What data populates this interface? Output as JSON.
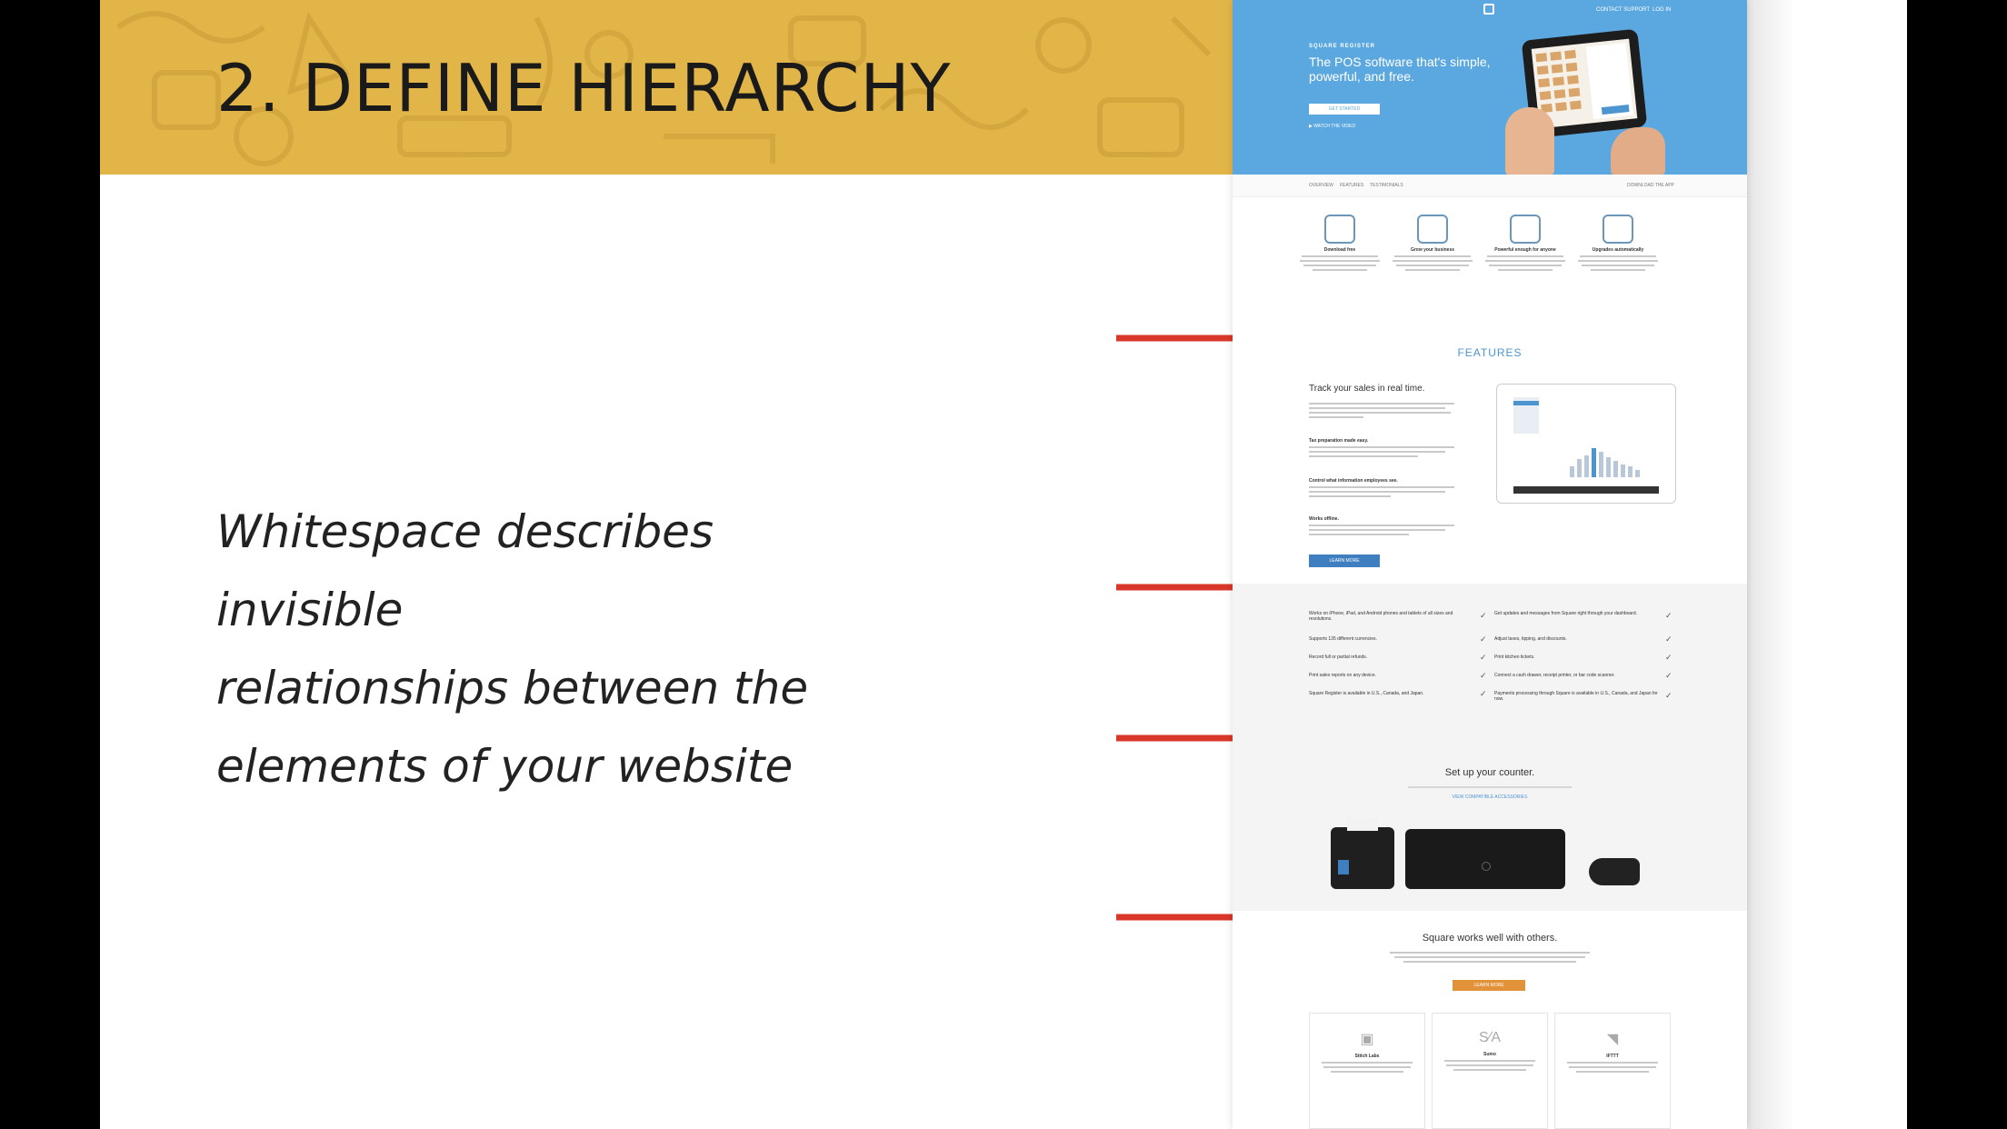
{
  "slide": {
    "title": "2. DEFINE HIERARCHY",
    "quote_lines": [
      "Whitespace describes invisible",
      "relationships between the",
      "elements of your website"
    ]
  },
  "colors": {
    "banner": "#e2b549",
    "arrow": "#d9372a",
    "hero_blue": "#5ba8e0",
    "features_blue": "#4c95d1",
    "learn_more_blue": "#3f7fc0",
    "orange_button": "#e2933a"
  },
  "website": {
    "hero": {
      "logo_icon": "square-logo-icon",
      "nav_links": [
        "CONTACT SUPPORT",
        "LOG IN"
      ],
      "eyebrow": "SQUARE REGISTER",
      "headline": "The POS software that's simple, powerful, and free.",
      "button": "GET STARTED",
      "video_link": "WATCH THE VIDEO"
    },
    "subnav": {
      "links": [
        "OVERVIEW",
        "FEATURES",
        "TESTIMONIALS"
      ],
      "right_link": "DOWNLOAD THE APP"
    },
    "feature_cards": [
      {
        "title": "Download free",
        "icon": "cloud-download-icon"
      },
      {
        "title": "Grow your business",
        "icon": "register-screen-icon"
      },
      {
        "title": "Powerful enough for anyone",
        "icon": "store-icon"
      },
      {
        "title": "Upgrades automatically",
        "icon": "monitor-icon"
      }
    ],
    "features": {
      "title": "FEATURES",
      "track_heading": "Track your sales in real time.",
      "subsections": [
        "Tax preparation made easy.",
        "Control what information employees see.",
        "Works offline."
      ],
      "learn_more": "LEARN MORE"
    },
    "checklist": {
      "left": [
        "Works on iPhone, iPad, and Android phones and tablets of all sizes and resolutions.",
        "Supports 135 different currencies.",
        "Record full or partial refunds.",
        "Print sales reports on any device.",
        "Square Register is available in U.S., Canada, and Japan."
      ],
      "right": [
        "Get updates and messages from Square right through your dashboard.",
        "Adjust taxes, tipping, and discounts.",
        "Print kitchen tickets.",
        "Connect a cash drawer, receipt printer, or bar code scanner.",
        "Payments processing through Square is available in U.S., Canada, and Japan for now."
      ]
    },
    "counter": {
      "title": "Set up your counter.",
      "link": "VIEW COMPATIBLE ACCESSORIES"
    },
    "others": {
      "title": "Square works well with others.",
      "button": "LEARN MORE",
      "partners": [
        {
          "name": "Stitch Labs",
          "glyph": "▣"
        },
        {
          "name": "Sumo",
          "glyph": "S∕A"
        },
        {
          "name": "IFTTT",
          "glyph": "◥"
        }
      ]
    }
  }
}
